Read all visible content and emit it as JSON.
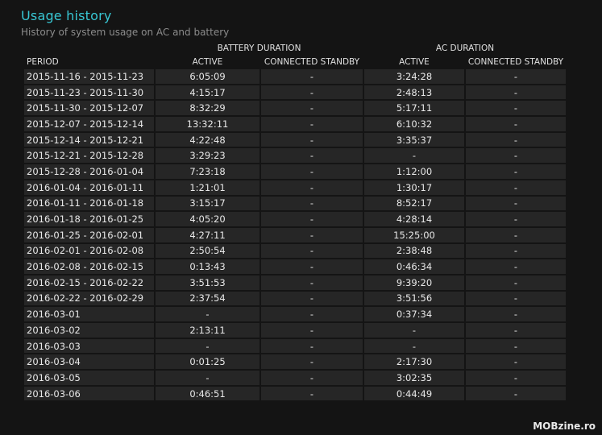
{
  "header": {
    "title": "Usage history",
    "subtitle": "History of system usage on AC and battery"
  },
  "table": {
    "group_headers": {
      "battery": "BATTERY DURATION",
      "ac": "AC DURATION"
    },
    "columns": {
      "period": "PERIOD",
      "battery_active": "ACTIVE",
      "battery_standby": "CONNECTED STANDBY",
      "ac_active": "ACTIVE",
      "ac_standby": "CONNECTED STANDBY"
    },
    "rows": [
      {
        "period": "2015-11-16 - 2015-11-23",
        "battery_active": "6:05:09",
        "battery_standby": "-",
        "ac_active": "3:24:28",
        "ac_standby": "-"
      },
      {
        "period": "2015-11-23 - 2015-11-30",
        "battery_active": "4:15:17",
        "battery_standby": "-",
        "ac_active": "2:48:13",
        "ac_standby": "-"
      },
      {
        "period": "2015-11-30 - 2015-12-07",
        "battery_active": "8:32:29",
        "battery_standby": "-",
        "ac_active": "5:17:11",
        "ac_standby": "-"
      },
      {
        "period": "2015-12-07 - 2015-12-14",
        "battery_active": "13:32:11",
        "battery_standby": "-",
        "ac_active": "6:10:32",
        "ac_standby": "-"
      },
      {
        "period": "2015-12-14 - 2015-12-21",
        "battery_active": "4:22:48",
        "battery_standby": "-",
        "ac_active": "3:35:37",
        "ac_standby": "-"
      },
      {
        "period": "2015-12-21 - 2015-12-28",
        "battery_active": "3:29:23",
        "battery_standby": "-",
        "ac_active": "-",
        "ac_standby": "-"
      },
      {
        "period": "2015-12-28 - 2016-01-04",
        "battery_active": "7:23:18",
        "battery_standby": "-",
        "ac_active": "1:12:00",
        "ac_standby": "-"
      },
      {
        "period": "2016-01-04 - 2016-01-11",
        "battery_active": "1:21:01",
        "battery_standby": "-",
        "ac_active": "1:30:17",
        "ac_standby": "-"
      },
      {
        "period": "2016-01-11 - 2016-01-18",
        "battery_active": "3:15:17",
        "battery_standby": "-",
        "ac_active": "8:52:17",
        "ac_standby": "-"
      },
      {
        "period": "2016-01-18 - 2016-01-25",
        "battery_active": "4:05:20",
        "battery_standby": "-",
        "ac_active": "4:28:14",
        "ac_standby": "-"
      },
      {
        "period": "2016-01-25 - 2016-02-01",
        "battery_active": "4:27:11",
        "battery_standby": "-",
        "ac_active": "15:25:00",
        "ac_standby": "-"
      },
      {
        "period": "2016-02-01 - 2016-02-08",
        "battery_active": "2:50:54",
        "battery_standby": "-",
        "ac_active": "2:38:48",
        "ac_standby": "-"
      },
      {
        "period": "2016-02-08 - 2016-02-15",
        "battery_active": "0:13:43",
        "battery_standby": "-",
        "ac_active": "0:46:34",
        "ac_standby": "-"
      },
      {
        "period": "2016-02-15 - 2016-02-22",
        "battery_active": "3:51:53",
        "battery_standby": "-",
        "ac_active": "9:39:20",
        "ac_standby": "-"
      },
      {
        "period": "2016-02-22 - 2016-02-29",
        "battery_active": "2:37:54",
        "battery_standby": "-",
        "ac_active": "3:51:56",
        "ac_standby": "-"
      },
      {
        "period": "2016-03-01",
        "battery_active": "-",
        "battery_standby": "-",
        "ac_active": "0:37:34",
        "ac_standby": "-"
      },
      {
        "period": "2016-03-02",
        "battery_active": "2:13:11",
        "battery_standby": "-",
        "ac_active": "-",
        "ac_standby": "-"
      },
      {
        "period": "2016-03-03",
        "battery_active": "-",
        "battery_standby": "-",
        "ac_active": "-",
        "ac_standby": "-"
      },
      {
        "period": "2016-03-04",
        "battery_active": "0:01:25",
        "battery_standby": "-",
        "ac_active": "2:17:30",
        "ac_standby": "-"
      },
      {
        "period": "2016-03-05",
        "battery_active": "-",
        "battery_standby": "-",
        "ac_active": "3:02:35",
        "ac_standby": "-"
      },
      {
        "period": "2016-03-06",
        "battery_active": "0:46:51",
        "battery_standby": "-",
        "ac_active": "0:44:49",
        "ac_standby": "-"
      }
    ]
  },
  "watermark": "MOBzine.ro"
}
